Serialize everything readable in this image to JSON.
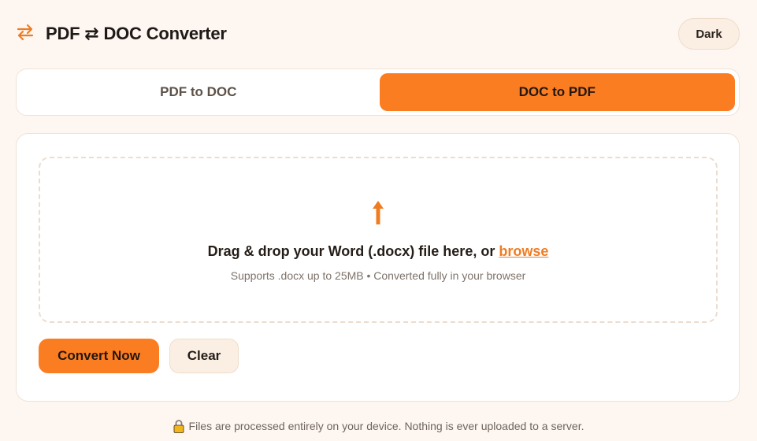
{
  "header": {
    "icon": "swap-arrows-icon",
    "title": "PDF ⇄ DOC Converter",
    "theme_toggle_label": "Dark"
  },
  "tabs": [
    {
      "label": "PDF to DOC",
      "active": false
    },
    {
      "label": "DOC to PDF",
      "active": true
    }
  ],
  "dropzone": {
    "icon": "upload-arrow-icon",
    "text": "Drag & drop your Word (.docx) file here, or ",
    "browse_label": "browse",
    "subtext": "Supports .docx up to 25MB • Converted fully in your browser"
  },
  "actions": {
    "convert_label": "Convert Now",
    "clear_label": "Clear"
  },
  "footer": {
    "icon": "lock-icon",
    "text": "Files are processed entirely on your device. Nothing is ever uploaded to a server."
  },
  "colors": {
    "accent": "#fb7d22",
    "background": "#fdf6f1",
    "card": "#ffffff"
  }
}
